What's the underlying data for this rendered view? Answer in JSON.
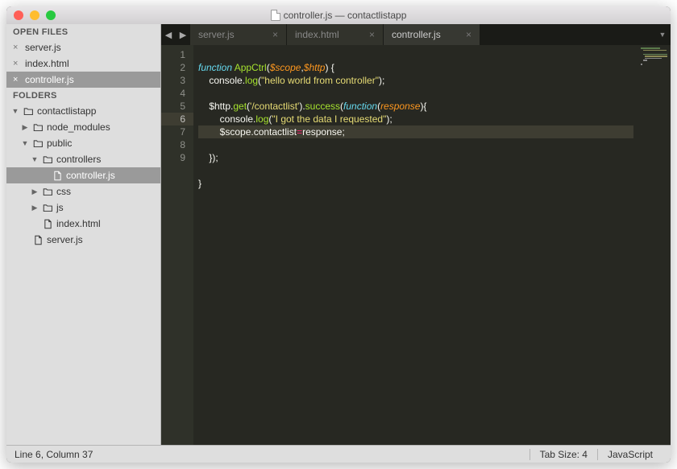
{
  "window": {
    "title": "controller.js — contactlistapp"
  },
  "sidebar": {
    "open_files_header": "OPEN FILES",
    "open_files": [
      {
        "name": "server.js",
        "active": false
      },
      {
        "name": "index.html",
        "active": false
      },
      {
        "name": "controller.js",
        "active": true
      }
    ],
    "folders_header": "FOLDERS",
    "tree": [
      {
        "depth": 0,
        "type": "folder",
        "open": true,
        "name": "contactlistapp"
      },
      {
        "depth": 1,
        "type": "folder",
        "open": false,
        "name": "node_modules"
      },
      {
        "depth": 1,
        "type": "folder",
        "open": true,
        "name": "public"
      },
      {
        "depth": 2,
        "type": "folder",
        "open": true,
        "name": "controllers"
      },
      {
        "depth": 3,
        "type": "file",
        "name": "controller.js",
        "selected": true
      },
      {
        "depth": 2,
        "type": "folder",
        "open": false,
        "name": "css"
      },
      {
        "depth": 2,
        "type": "folder",
        "open": false,
        "name": "js"
      },
      {
        "depth": 2,
        "type": "file",
        "name": "index.html"
      },
      {
        "depth": 1,
        "type": "file",
        "name": "server.js"
      }
    ]
  },
  "tabs": [
    {
      "label": "server.js",
      "active": false
    },
    {
      "label": "index.html",
      "active": false
    },
    {
      "label": "controller.js",
      "active": true
    }
  ],
  "code": {
    "line_numbers": [
      "1",
      "2",
      "3",
      "4",
      "5",
      "6",
      "7",
      "8",
      "9"
    ],
    "highlight_line": 6,
    "tokens": {
      "l1_kw": "function",
      "l1_fn": " AppCtrl",
      "l1_p1": "(",
      "l1_v1": "$scope",
      "l1_c": ",",
      "l1_v2": "$http",
      "l1_p2": ") {",
      "l2": "    console.",
      "l2_fn": "log",
      "l2_p": "(",
      "l2_str": "\"hello world from controller\"",
      "l2_e": ");",
      "l4_a": "    $http.",
      "l4_fn": "get",
      "l4_p": "(",
      "l4_str": "'/contactlist'",
      "l4_b": ").",
      "l4_fn2": "success",
      "l4_p2": "(",
      "l4_kw": "function",
      "l4_p3": "(",
      "l4_v": "response",
      "l4_p4": "){",
      "l5_a": "        console.",
      "l5_fn": "log",
      "l5_p": "(",
      "l5_str": "\"I got the data I requested\"",
      "l5_e": ");",
      "l6_a": "        $scope.contactlist",
      "l6_op": "=",
      "l6_b": "response;",
      "l7": "    });",
      "l9": "}"
    }
  },
  "status": {
    "left": "Line 6, Column 37",
    "tab_size": "Tab Size: 4",
    "lang": "JavaScript"
  }
}
